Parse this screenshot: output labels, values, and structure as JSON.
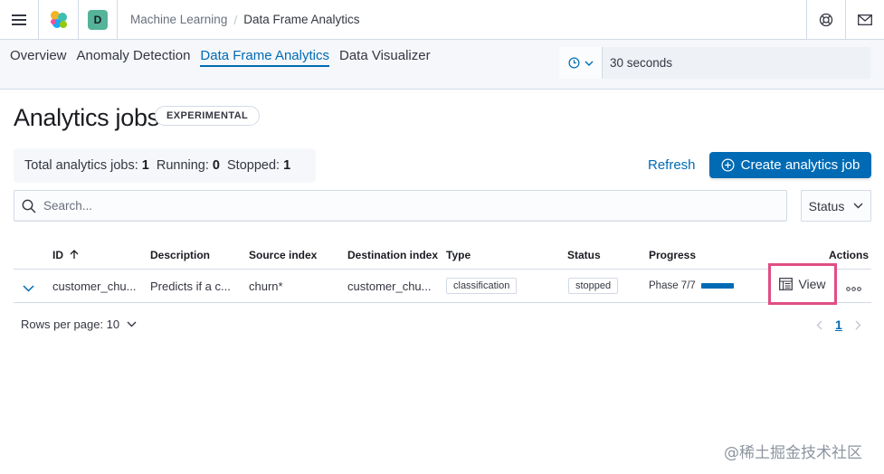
{
  "header": {
    "space_initial": "D",
    "breadcrumbs": [
      "Machine Learning",
      "Data Frame Analytics"
    ]
  },
  "nav": {
    "tabs": [
      "Overview",
      "Anomaly Detection",
      "Data Frame Analytics",
      "Data Visualizer"
    ],
    "active_tab": "Data Frame Analytics",
    "refresh_interval": "30 seconds"
  },
  "page": {
    "title": "Analytics jobs",
    "badge": "EXPERIMENTAL",
    "stats": {
      "total_label": "Total analytics jobs:",
      "total": "1",
      "running_label": "Running:",
      "running": "0",
      "stopped_label": "Stopped:",
      "stopped": "1"
    },
    "refresh_label": "Refresh",
    "create_label": "Create analytics job"
  },
  "search": {
    "placeholder": "Search...",
    "value": ""
  },
  "status_filter": "Status",
  "table": {
    "columns": [
      "ID",
      "Description",
      "Source index",
      "Destination index",
      "Type",
      "Status",
      "Progress",
      "Actions"
    ],
    "sort_column": "ID",
    "rows": [
      {
        "id": "customer_chu...",
        "description": "Predicts if a c...",
        "source_index": "churn*",
        "destination_index": "customer_chu...",
        "type": "classification",
        "status": "stopped",
        "progress_label": "Phase 7/7",
        "progress_fraction": 1.0,
        "view_label": "View"
      }
    ]
  },
  "footer": {
    "rows_per_page": "Rows per page: 10",
    "current_page": "1"
  },
  "watermark": "@稀土掘金技术社区",
  "colors": {
    "primary": "#006bb4",
    "highlight": "#e04e84",
    "space_badge": "#54b399"
  }
}
